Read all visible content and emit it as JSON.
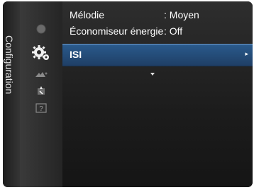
{
  "sidebar": {
    "title": "Configuration"
  },
  "menu": {
    "rows": [
      {
        "label": "Mélodie",
        "value": ": Moyen"
      },
      {
        "label": "Économiseur énergie",
        "value": ": Off"
      }
    ],
    "selected": {
      "label": "ISI"
    }
  },
  "icons": [
    "picture-icon",
    "settings-gear-icon",
    "input-icon",
    "channel-icon",
    "support-icon"
  ],
  "colors": {
    "selection": "#2a5a8c",
    "background": "#2a2a2a"
  }
}
